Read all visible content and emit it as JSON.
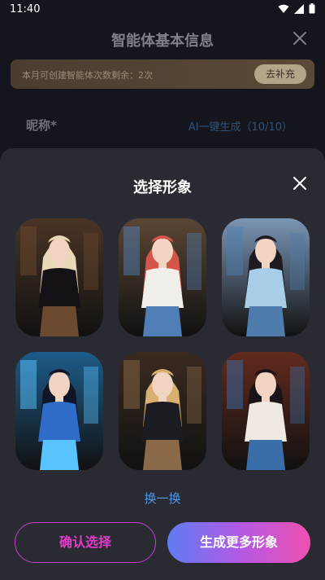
{
  "status": {
    "time": "11:40"
  },
  "background": {
    "title": "智能体基本信息",
    "quota_text": "本月可创建智能体次数剩余：2次",
    "quota_button": "去补充",
    "nickname_label": "昵称*",
    "ai_generate": "AI一键生成（10/10）"
  },
  "sheet": {
    "title": "选择形象",
    "refresh_label": "换一换",
    "confirm_label": "确认选择",
    "generate_more_label": "生成更多形象"
  },
  "avatars": [
    {
      "name": "avatar-1",
      "bg": "#4a3424",
      "outfit": "#151217",
      "hair": "#e8d9b8",
      "accent": "#6b4a30"
    },
    {
      "name": "avatar-2",
      "bg": "#5a4634",
      "outfit": "#f0eee8",
      "hair": "#d4564a",
      "accent": "#4f7fb6"
    },
    {
      "name": "avatar-3",
      "bg": "#7b95b4",
      "outfit": "#a9cfe8",
      "hair": "#1e1a22",
      "accent": "#4e7dad"
    },
    {
      "name": "avatar-4",
      "bg": "#1d5c8a",
      "outfit": "#2f6cc9",
      "hair": "#101628",
      "accent": "#59c4ff"
    },
    {
      "name": "avatar-5",
      "bg": "#3a2a20",
      "outfit": "#1b1b22",
      "hair": "#d8b070",
      "accent": "#8a6a48"
    },
    {
      "name": "avatar-6",
      "bg": "#612a1e",
      "outfit": "#efe9e2",
      "hair": "#1a1418",
      "accent": "#3a6ea8"
    }
  ],
  "colors": {
    "sheet_bg": "#2a2a33",
    "accent_blue": "#4c97e8",
    "confirm_border": "#c63ed0",
    "gradient_start": "#5f7cf2",
    "gradient_end": "#f04fb0"
  }
}
